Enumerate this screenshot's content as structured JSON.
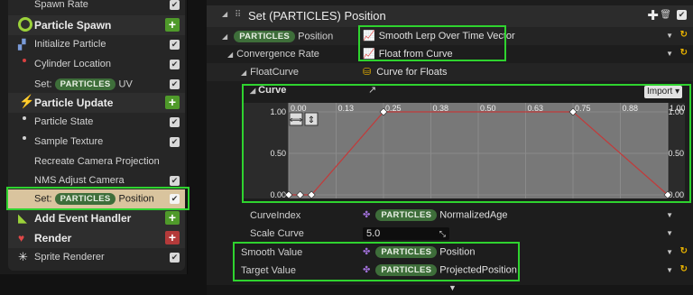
{
  "left": {
    "items": [
      {
        "label": "Spawn Rate",
        "kind": "item"
      },
      {
        "label": "Particle Spawn",
        "kind": "section",
        "icon": "ring-icon",
        "color": "#9bd23a"
      },
      {
        "label": "Initialize Particle",
        "kind": "item"
      },
      {
        "label": "Cylinder Location",
        "kind": "item"
      },
      {
        "prefix": "Set:",
        "pill": "PARTICLES",
        "suffix": "UV",
        "kind": "set"
      },
      {
        "label": "Particle Update",
        "kind": "section",
        "icon": "lightning-icon",
        "color": "#e6b000"
      },
      {
        "label": "Particle State",
        "kind": "item"
      },
      {
        "label": "Sample Texture",
        "kind": "item"
      },
      {
        "label": "Recreate Camera Projection",
        "kind": "item"
      },
      {
        "label": "NMS Adjust Camera",
        "kind": "item"
      },
      {
        "prefix": "Set:",
        "pill": "PARTICLES",
        "suffix": "Position",
        "kind": "set-selected"
      },
      {
        "label": "Add Event Handler",
        "kind": "section",
        "icon": "signal-icon",
        "color": "#9bd23a"
      },
      {
        "label": "Render",
        "kind": "section",
        "icon": "render-icon",
        "color": "#e04848"
      },
      {
        "label": "Sprite Renderer",
        "kind": "item"
      }
    ]
  },
  "panel": {
    "title": "Set (PARTICLES) Position",
    "position_pill": "PARTICLES",
    "position_label": "Position",
    "position_value": "Smooth Lerp Over Time Vector",
    "convergence_label": "Convergence Rate",
    "convergence_value": "Float from Curve",
    "floatcurve_label": "FloatCurve",
    "floatcurve_value": "Curve for Floats",
    "curve_label": "Curve",
    "import_label": "Import",
    "curveindex_label": "CurveIndex",
    "curveindex_pill": "PARTICLES",
    "curveindex_value": "NormalizedAge",
    "scale_label": "Scale Curve",
    "scale_value": "5.0",
    "smooth_label": "Smooth Value",
    "smooth_pill": "PARTICLES",
    "smooth_value": "Position",
    "target_label": "Target Value",
    "target_pill": "PARTICLES",
    "target_value": "ProjectedPosition"
  },
  "chart_data": {
    "type": "line",
    "x": [
      0.0,
      0.03,
      0.06,
      0.25,
      0.75,
      1.0
    ],
    "y": [
      0.0,
      0.0,
      0.0,
      1.0,
      1.0,
      0.0
    ],
    "x_ticks": [
      "0.00",
      "0.13",
      "0.25",
      "0.38",
      "0.50",
      "0.63",
      "0.75",
      "0.88",
      "1.00"
    ],
    "y_ticks": [
      "1.00",
      "0.50",
      "0.00"
    ],
    "xlim": [
      0,
      1
    ],
    "ylim": [
      0,
      1
    ],
    "line_color": "#c23a3a"
  }
}
